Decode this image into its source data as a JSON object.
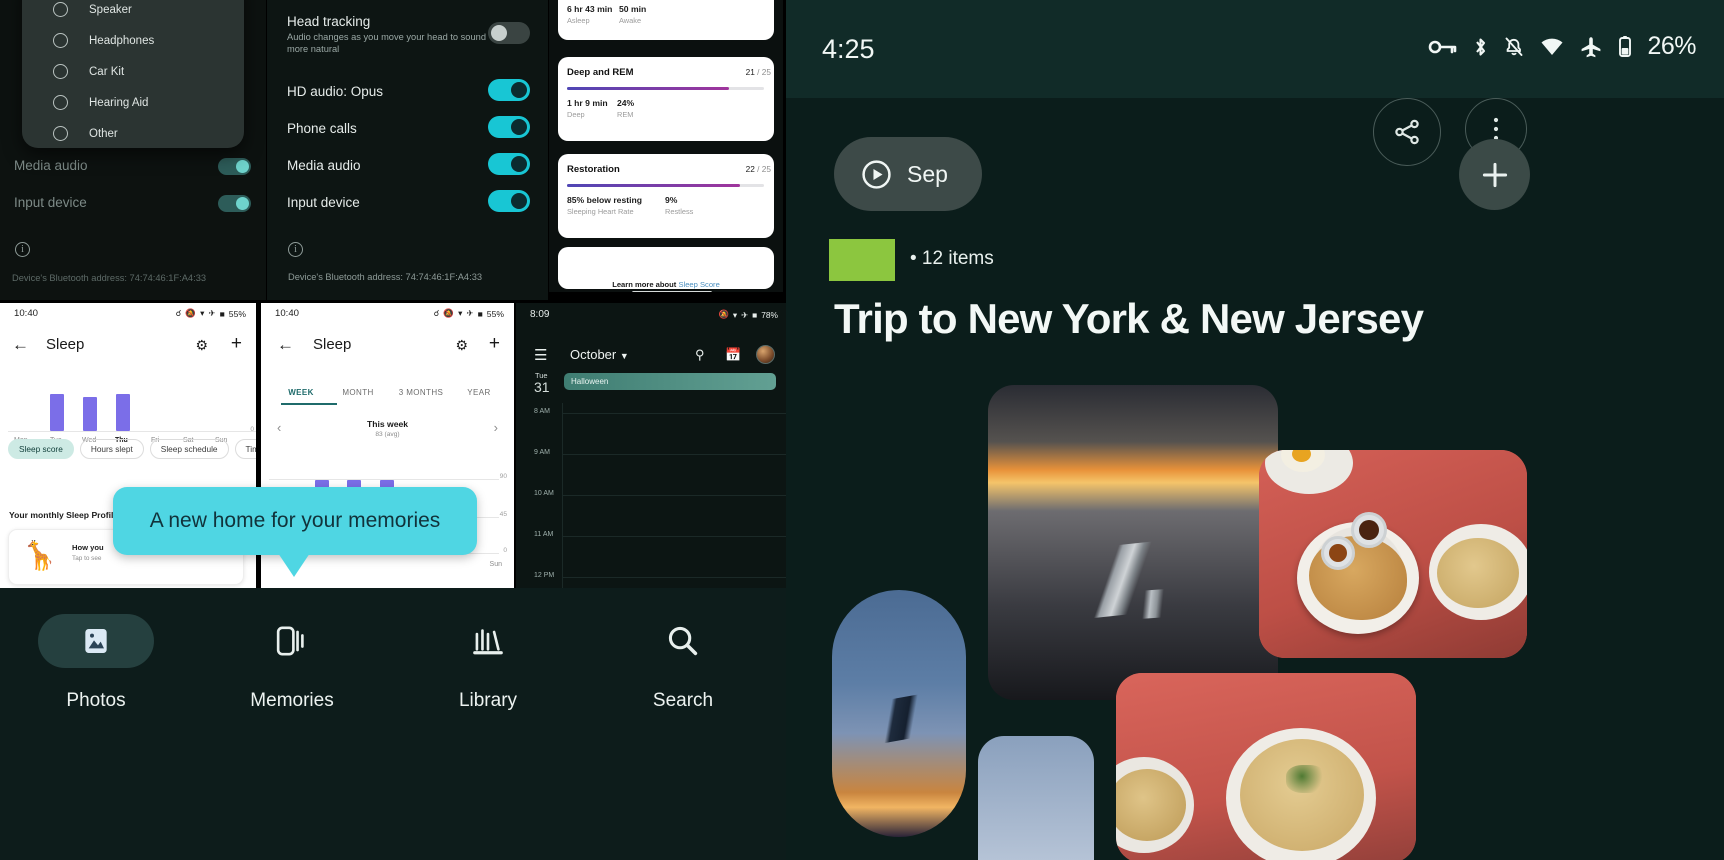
{
  "panel_bluetooth_dialog": {
    "name": "bluetooth-device-type-dialog",
    "options": [
      "Speaker",
      "Headphones",
      "Car Kit",
      "Hearing Aid",
      "Other"
    ],
    "behind_rows": [
      {
        "label": "Media audio",
        "toggle": "on"
      },
      {
        "label": "Input device",
        "toggle": "on"
      }
    ],
    "footer_note": "Device's Bluetooth address: 74:74:46:1F:A4:33"
  },
  "panel_bluetooth_settings": {
    "head_tracking": {
      "title": "Head tracking",
      "subtitle": "Audio changes as you move your head to sound more natural",
      "toggle": "off"
    },
    "rows": [
      {
        "label": "HD audio: Opus",
        "toggle": "on"
      },
      {
        "label": "Phone calls",
        "toggle": "on"
      },
      {
        "label": "Media audio",
        "toggle": "on"
      },
      {
        "label": "Input device",
        "toggle": "on"
      }
    ],
    "footer_note": "Device's Bluetooth address: 74:74:46:1F:A4:33"
  },
  "panel_sleep_score": {
    "top_card": {
      "value_1": "6 hr 43 min",
      "label_1": "Asleep",
      "value_2": "50 min",
      "label_2": "Awake"
    },
    "cards": [
      {
        "title": "Deep and REM",
        "score": "21",
        "score_total": "/ 25",
        "progress": 0.82,
        "value_1": "1 hr 9 min",
        "label_1": "Deep",
        "value_2": "24%",
        "label_2": "REM"
      },
      {
        "title": "Restoration",
        "score": "22",
        "score_total": "/ 25",
        "progress": 0.88,
        "value_1": "85% below resting",
        "label_1": "Sleeping Heart Rate",
        "value_2": "9%",
        "label_2": "Restless"
      }
    ],
    "learn_more_prefix": "Learn more about ",
    "learn_more_link": "Sleep Score"
  },
  "panel_sleep_week": {
    "status_bar": {
      "time": "10:40",
      "battery": "55%"
    },
    "app_title": "Sleep",
    "chart": {
      "days": [
        "Mon",
        "Tue",
        "Wed",
        "Thu",
        "Fri",
        "Sat",
        "Sun"
      ],
      "selected_day": "Thu",
      "values": [
        0,
        72,
        62,
        70,
        0,
        0,
        0
      ],
      "axis_max_label": "0"
    },
    "chips": [
      "Sleep score",
      "Hours slept",
      "Sleep schedule",
      "Time"
    ],
    "selected_chip": "Sleep score",
    "section_title": "Your monthly Sleep Profile",
    "profile_card": {
      "title": "How you",
      "subtitle": "Tap to see"
    }
  },
  "panel_sleep_tabs": {
    "status_bar": {
      "time": "10:40",
      "battery": "55%"
    },
    "app_title": "Sleep",
    "tabs": [
      "WEEK",
      "MONTH",
      "3 MONTHS",
      "YEAR"
    ],
    "active_tab": "WEEK",
    "range_title": "This week",
    "range_sub": "83 (avg)",
    "y_labels": [
      "90",
      "45",
      "0"
    ],
    "x_label": "Sun"
  },
  "panel_calendar": {
    "status_bar": {
      "time": "8:09",
      "battery": "78%"
    },
    "month": "October",
    "day_name": "Tue",
    "day_number": "31",
    "event": "Halloween",
    "hours": [
      "8 AM",
      "9 AM",
      "10 AM",
      "11 AM",
      "12 PM"
    ],
    "icons": [
      "menu-icon",
      "search-icon",
      "calendar-icon",
      "avatar"
    ]
  },
  "tooltip": {
    "text": "A new home for your memories",
    "color": "#4fd6e3"
  },
  "photos_nav": {
    "items": [
      {
        "label": "Photos",
        "icon": "photo-icon",
        "selected": true
      },
      {
        "label": "Memories",
        "icon": "memories-icon",
        "selected": false
      },
      {
        "label": "Library",
        "icon": "library-icon",
        "selected": false
      },
      {
        "label": "Search",
        "icon": "search-icon",
        "selected": false
      }
    ]
  },
  "memory_view": {
    "status_bar": {
      "time": "4:25",
      "battery": "26%",
      "icons": [
        "vpn-key-icon",
        "bluetooth-icon",
        "notifications-off-icon",
        "wifi-icon",
        "airplane-mode-icon",
        "battery-icon"
      ]
    },
    "play_chip": {
      "label": "Sep",
      "icon": "play-icon"
    },
    "share_icon": "share-icon",
    "more_icon": "more-vert-icon",
    "add_icon": "add-icon",
    "swatch_color": "#8cc63f",
    "item_count": "• 12 items",
    "title": "Trip to New York & New Jersey",
    "background": "#0b1d1b",
    "photos": [
      {
        "name": "airplane-wing-sunset"
      },
      {
        "name": "indian-breakfast-red-table"
      },
      {
        "name": "indian-breakfast-closeup"
      },
      {
        "name": "airplane-window-dusk"
      },
      {
        "name": "airplane-window-partial"
      }
    ]
  }
}
